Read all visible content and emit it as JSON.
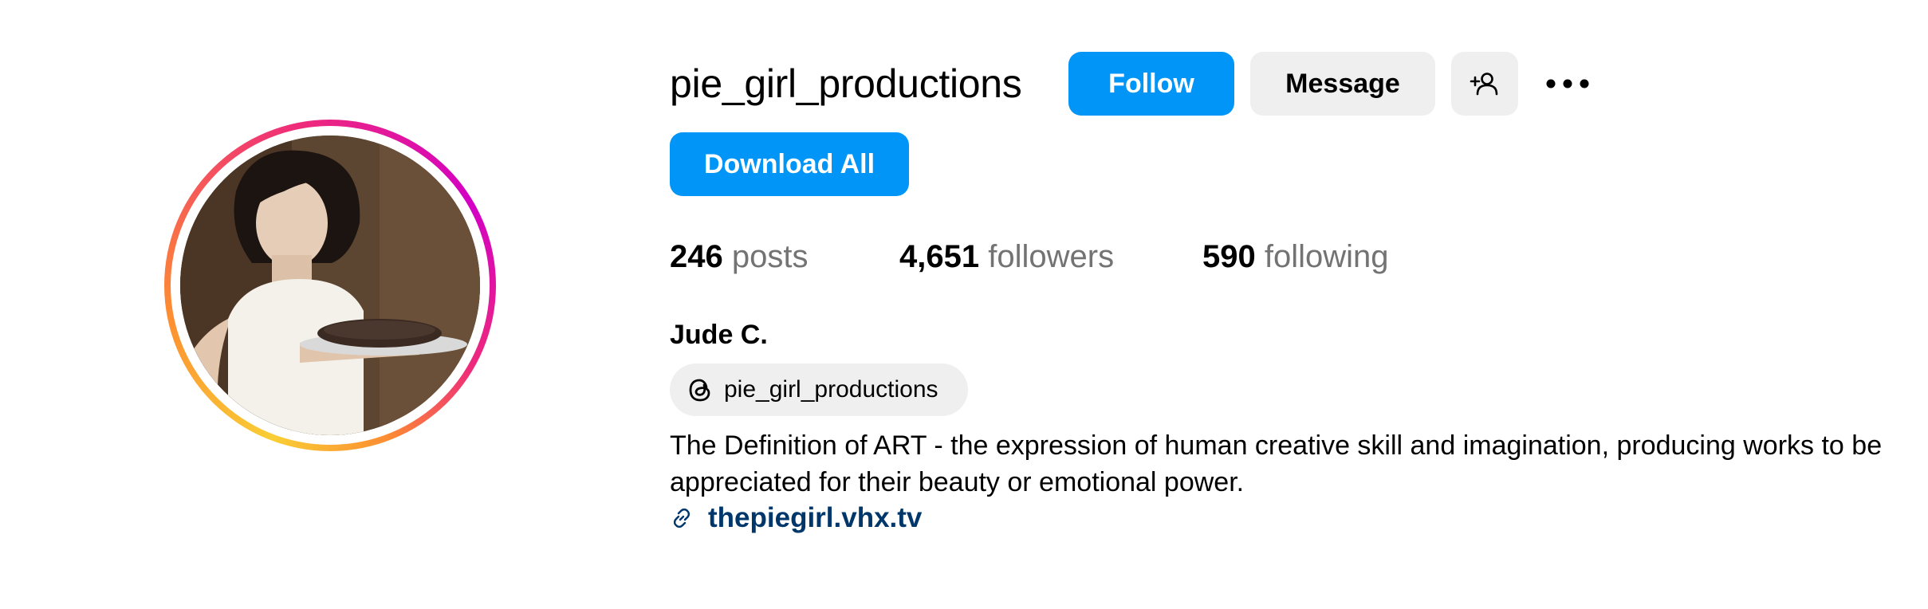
{
  "profile": {
    "username": "pie_girl_productions",
    "display_name": "Jude C.",
    "bio": "The Definition of ART - the expression of human creative skill and imagination, producing works to be appreciated for their beauty or emotional power.",
    "link": "thepiegirl.vhx.tv",
    "threads_handle": "pie_girl_productions"
  },
  "actions": {
    "follow_label": "Follow",
    "message_label": "Message",
    "download_label": "Download All",
    "add_user_icon": "person-plus-icon",
    "more_icon": "more-horizontal-icon"
  },
  "stats": {
    "posts_count": "246",
    "posts_label": "posts",
    "followers_count": "4,651",
    "followers_label": "followers",
    "following_count": "590",
    "following_label": "following"
  },
  "colors": {
    "primary_button": "#0095f6",
    "secondary_button": "#efefef",
    "link": "#00376b",
    "muted_text": "#737373",
    "story_ring": [
      "#f9ce34",
      "#ee2a7b",
      "#d300c5"
    ]
  }
}
